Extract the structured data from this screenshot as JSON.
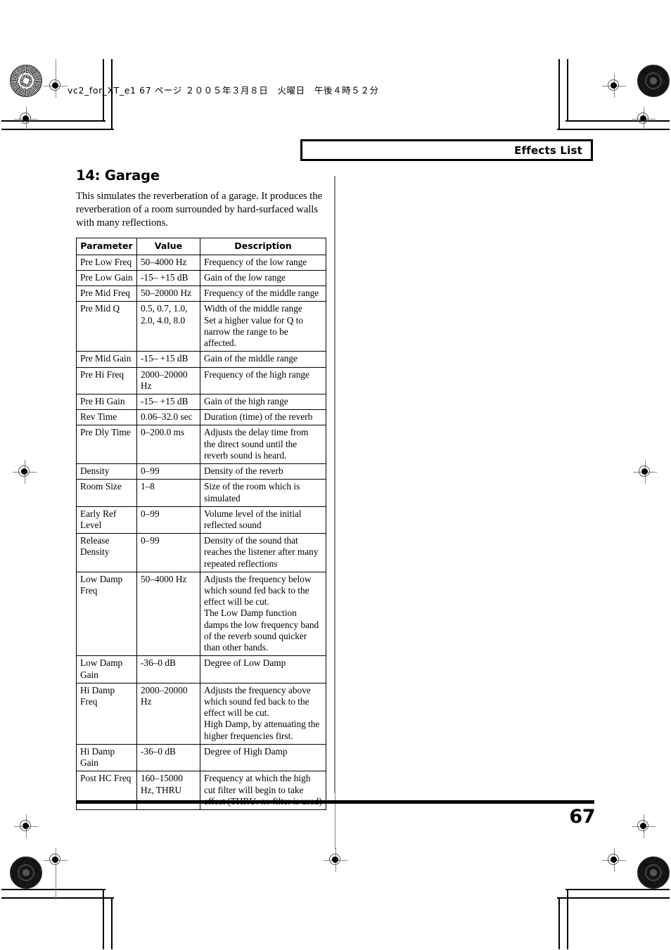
{
  "slug": {
    "text": "vc2_for_XT_e1  67 ページ  ２００５年３月８日　火曜日　午後４時５２分"
  },
  "header": {
    "title": "Effects List"
  },
  "section": {
    "title": "14: Garage",
    "intro": "This simulates the reverberation of a garage. It produces the reverberation of a room surrounded by hard-surfaced walls with many reflections."
  },
  "table": {
    "columns": [
      "Parameter",
      "Value",
      "Description"
    ],
    "rows": [
      {
        "parameter": "Pre Low Freq",
        "value": "50–4000 Hz",
        "description": "Frequency of the low range"
      },
      {
        "parameter": "Pre Low Gain",
        "value": "-15– +15 dB",
        "description": "Gain of the low range"
      },
      {
        "parameter": "Pre Mid Freq",
        "value": "50–20000 Hz",
        "description": "Frequency of the middle range"
      },
      {
        "parameter": "Pre Mid Q",
        "value": "0.5, 0.7, 1.0, 2.0, 4.0, 8.0",
        "description": "Width of the middle range\nSet a higher value for Q to narrow the range to be affected."
      },
      {
        "parameter": "Pre Mid Gain",
        "value": "-15– +15 dB",
        "description": "Gain of the middle range"
      },
      {
        "parameter": "Pre Hi Freq",
        "value": "2000–20000 Hz",
        "description": "Frequency of the high range"
      },
      {
        "parameter": "Pre Hi Gain",
        "value": "-15– +15 dB",
        "description": "Gain of the high range"
      },
      {
        "parameter": "Rev Time",
        "value": "0.06–32.0 sec",
        "description": "Duration (time) of the reverb"
      },
      {
        "parameter": "Pre Dly Time",
        "value": "0–200.0 ms",
        "description": "Adjusts the delay time from the direct sound until the reverb sound is heard."
      },
      {
        "parameter": "Density",
        "value": "0–99",
        "description": "Density of the reverb"
      },
      {
        "parameter": "Room Size",
        "value": "1–8",
        "description": "Size of the room which is simulated"
      },
      {
        "parameter": "Early Ref Level",
        "value": "0–99",
        "description": "Volume level of the initial reflected sound"
      },
      {
        "parameter": "Release Density",
        "value": "0–99",
        "description": "Density of the sound that reaches the listener after many repeated reflections"
      },
      {
        "parameter": "Low Damp Freq",
        "value": "50–4000 Hz",
        "description": "Adjusts the frequency below which sound fed back to the effect will be cut.\nThe Low Damp function damps the low frequency band of the reverb sound quicker than other bands."
      },
      {
        "parameter": "Low Damp Gain",
        "value": "-36–0 dB",
        "description": "Degree of Low Damp"
      },
      {
        "parameter": "Hi Damp Freq",
        "value": "2000–20000 Hz",
        "description": "Adjusts the frequency above which sound fed back to the effect will be cut.\nHigh Damp, by attenuating the higher frequencies first."
      },
      {
        "parameter": "Hi Damp Gain",
        "value": "-36–0 dB",
        "description": "Degree of High Damp"
      },
      {
        "parameter": "Post HC Freq",
        "value": "160–15000 Hz, THRU",
        "description": "Frequency at which the high cut filter will begin to take effect (THRU: no filter is used)"
      }
    ]
  },
  "footer": {
    "page_number": "67"
  }
}
